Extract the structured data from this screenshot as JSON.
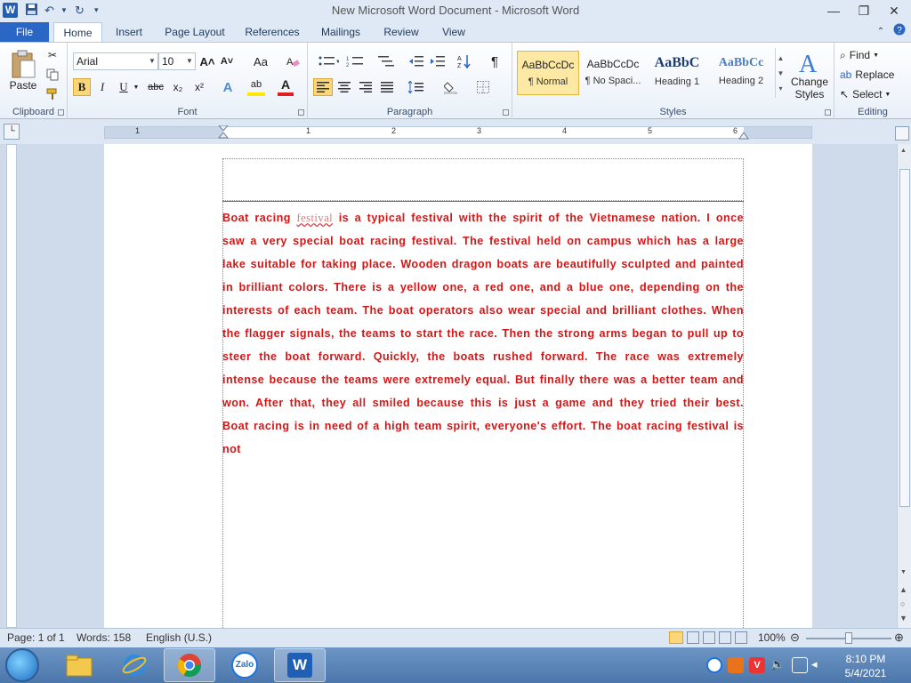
{
  "window": {
    "app_letter": "W",
    "title": "New Microsoft Word Document - Microsoft Word",
    "minimize": "—",
    "restore": "❐",
    "close": "✕"
  },
  "tabs": {
    "file": "File",
    "items": [
      "Home",
      "Insert",
      "Page Layout",
      "References",
      "Mailings",
      "Review",
      "View"
    ]
  },
  "ribbon": {
    "clipboard": {
      "label": "Clipboard",
      "paste": "Paste"
    },
    "font": {
      "label": "Font",
      "font_name": "Arial",
      "font_size": "10",
      "grow": "A˄",
      "shrink": "A˅",
      "change_case": "Aa",
      "bold": "B",
      "italic": "I",
      "underline": "U",
      "strikethrough": "abc",
      "subscript": "x₂",
      "superscript": "x²",
      "text_effects": "A",
      "highlight": "ab",
      "font_color": "A"
    },
    "paragraph": {
      "label": "Paragraph",
      "pilcrow": "¶"
    },
    "styles": {
      "label": "Styles",
      "items": [
        {
          "sample": "AaBbCcDc",
          "name": "¶ Normal"
        },
        {
          "sample": "AaBbCcDc",
          "name": "¶ No Spaci..."
        },
        {
          "sample": "AaBbC",
          "name": "Heading 1"
        },
        {
          "sample": "AaBbCc",
          "name": "Heading 2"
        }
      ],
      "change_styles_line1": "Change",
      "change_styles_line2": "Styles"
    },
    "editing": {
      "label": "Editing",
      "find": "Find",
      "replace": "Replace",
      "select": "Select"
    }
  },
  "ruler": {
    "labels": [
      "1",
      "1",
      "2",
      "3",
      "4",
      "5",
      "6"
    ]
  },
  "document": {
    "lead": "Boat racing",
    "misspelled_word": "festival",
    "body": "is a typical festival with the spirit of the Vietnamese nation. I once saw a very special boat racing festival. The festival held on campus which has a large lake suitable for taking place. Wooden dragon boats are beautifully sculpted and painted in brilliant colors. There is a yellow one, a red one, and a blue one, depending on the interests of each team. The boat operators also wear special and brilliant clothes. When the flagger signals, the teams to start the race. Then the strong arms began to pull up to steer the boat forward. Quickly, the boats rushed forward. The race was extremely intense because the teams were extremely equal. But finally there was a better team and won. After that, they all smiled because this is just a game and they tried their best. Boat racing is in need of a high team spirit, everyone's effort. The boat racing festival is not"
  },
  "statusbar": {
    "page": "Page: 1 of 1",
    "words": "Words: 158",
    "language": "English (U.S.)",
    "zoom": "100%"
  },
  "taskbar": {
    "apps": [
      "explorer-icon",
      "internet-explorer-icon",
      "chrome-icon",
      "zalo-icon",
      "word-icon"
    ],
    "zalo_label": "Zalo",
    "word_label": "W",
    "time": "8:10 PM",
    "date": "5/4/2021"
  },
  "colors": {
    "document_text": "#d01818",
    "file_tab": "#2a66c4",
    "taskbar": "#4c77ab"
  }
}
